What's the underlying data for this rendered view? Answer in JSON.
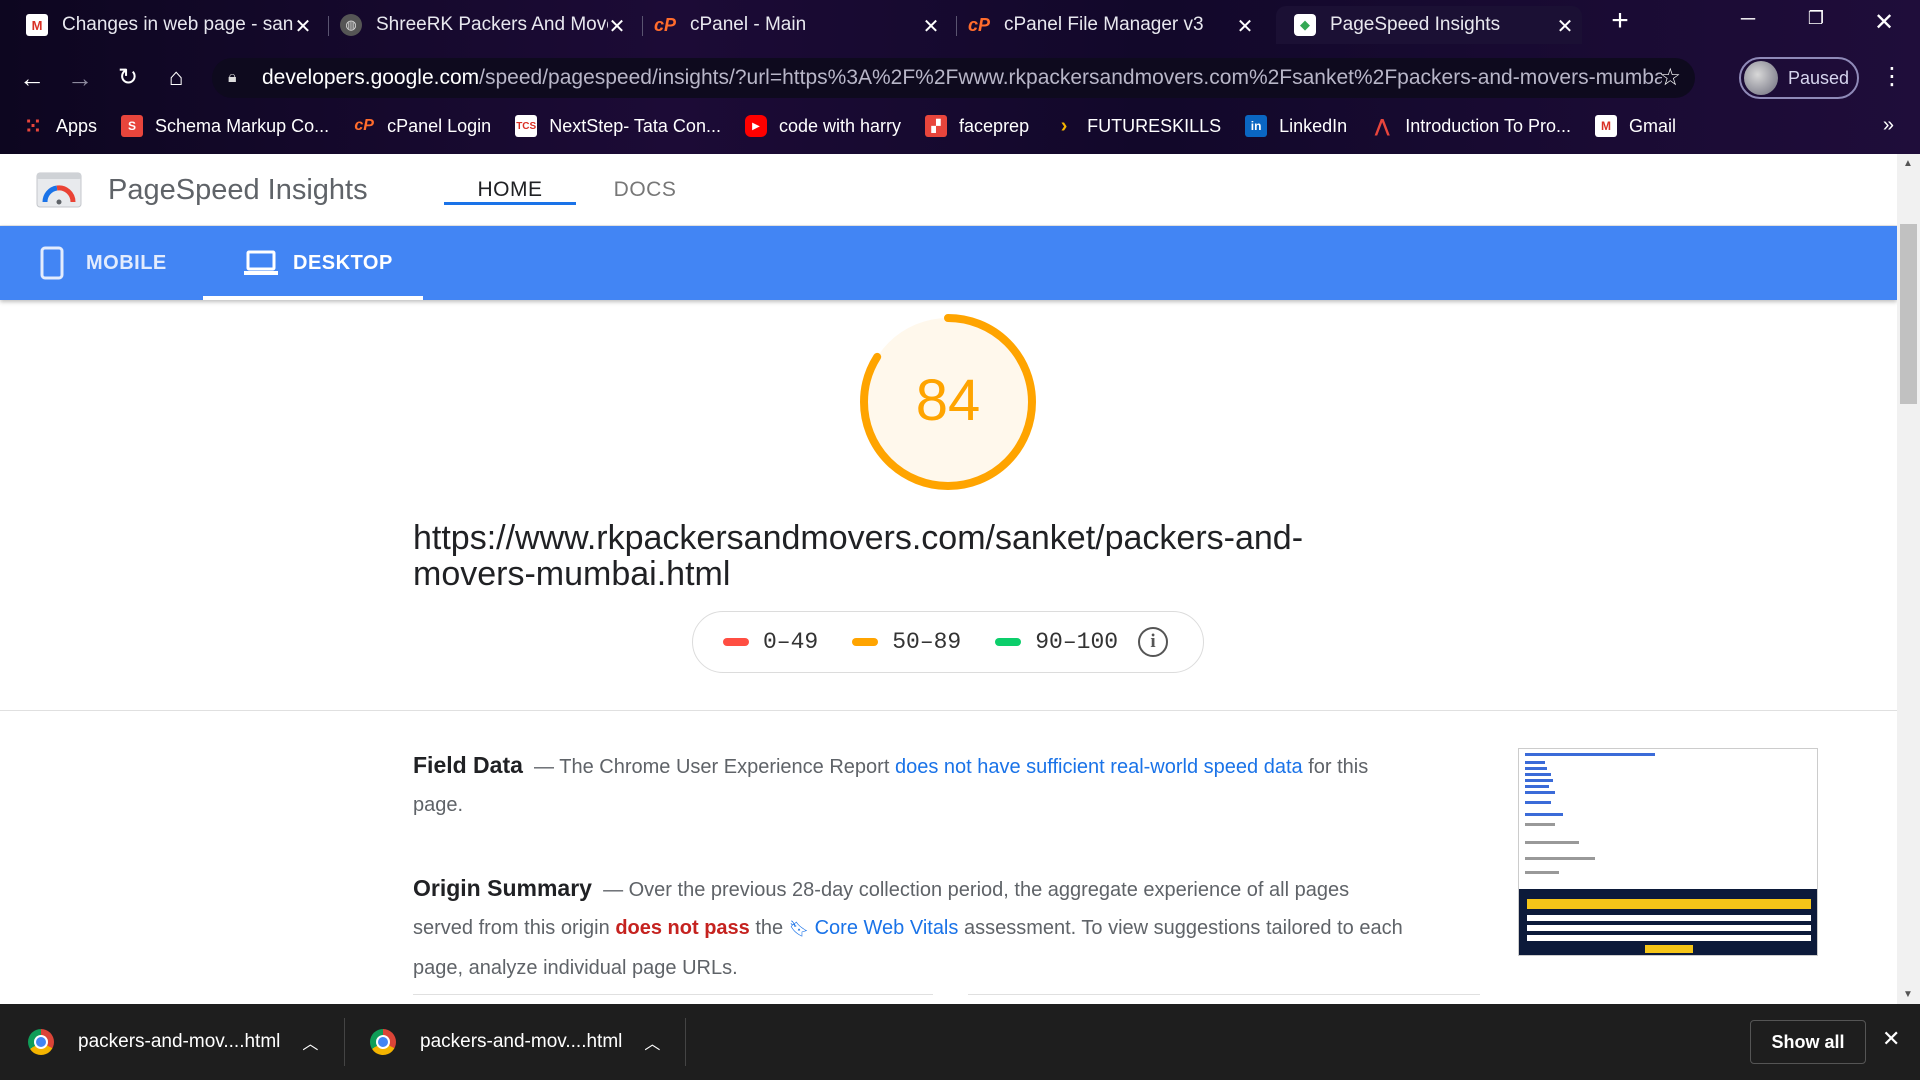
{
  "browser": {
    "tabs": [
      {
        "title": "Changes in web page - sanket",
        "icon": "gmail-icon",
        "active": false
      },
      {
        "title": "ShreeRK Packers And Movers",
        "icon": "globe-icon",
        "active": false
      },
      {
        "title": "cPanel - Main",
        "icon": "cpanel-icon",
        "active": false
      },
      {
        "title": "cPanel File Manager v3",
        "icon": "cpanel-icon",
        "active": false
      },
      {
        "title": "PageSpeed Insights",
        "icon": "pagespeed-icon",
        "active": true
      }
    ],
    "new_tab": "+",
    "url_host": "developers.google.com",
    "url_path": "/speed/pagespeed/insights/?url=https%3A%2F%2Fwww.rkpackersandmovers.com%2Fsanket%2Fpackers-and-movers-mumbai...",
    "profile_label": "Paused",
    "bookmarks": [
      {
        "label": "Apps",
        "icon": "apps-grid-icon"
      },
      {
        "label": "Schema Markup Co...",
        "icon": "schema-icon"
      },
      {
        "label": "cPanel Login",
        "icon": "cpanel-icon"
      },
      {
        "label": "NextStep- Tata Con...",
        "icon": "tcs-icon"
      },
      {
        "label": "code with harry",
        "icon": "youtube-icon"
      },
      {
        "label": "faceprep",
        "icon": "faceprep-icon"
      },
      {
        "label": "FUTURESKILLS",
        "icon": "futureskills-icon"
      },
      {
        "label": "LinkedIn",
        "icon": "linkedin-icon"
      },
      {
        "label": "Introduction To Pro...",
        "icon": "course-icon"
      },
      {
        "label": "Gmail",
        "icon": "gmail-icon"
      }
    ],
    "bookmarks_more": "»"
  },
  "psi": {
    "app_title": "PageSpeed Insights",
    "nav": {
      "home": "HOME",
      "docs": "DOCS"
    },
    "devices": {
      "mobile": "MOBILE",
      "desktop": "DESKTOP",
      "selected": "desktop"
    },
    "score": 84,
    "score_color": "#ffa400",
    "tested_url": "https://www.rkpackersandmovers.com/sanket/packers-and-movers-mumbai.html",
    "legend": [
      {
        "range": "0–49",
        "color": "#ff4e42"
      },
      {
        "range": "50–89",
        "color": "#ffa400"
      },
      {
        "range": "90–100",
        "color": "#0cce6b"
      }
    ],
    "field_data": {
      "heading": "Field Data",
      "dash": "—",
      "text_before": "The Chrome User Experience Report",
      "link": "does not have sufficient real-world speed data",
      "text_after": "for this page."
    },
    "origin_summary": {
      "heading": "Origin Summary",
      "dash": "—",
      "text_1": "Over the previous 28-day collection period, the aggregate experience of all pages served from this origin",
      "fail": "does not pass",
      "text_2": "the",
      "link": "Core Web Vitals",
      "text_3": "assessment. To view suggestions tailored to each page, analyze individual page URLs."
    }
  },
  "downloads": {
    "items": [
      {
        "name": "packers-and-mov....html"
      },
      {
        "name": "packers-and-mov....html"
      }
    ],
    "show_all": "Show all"
  }
}
